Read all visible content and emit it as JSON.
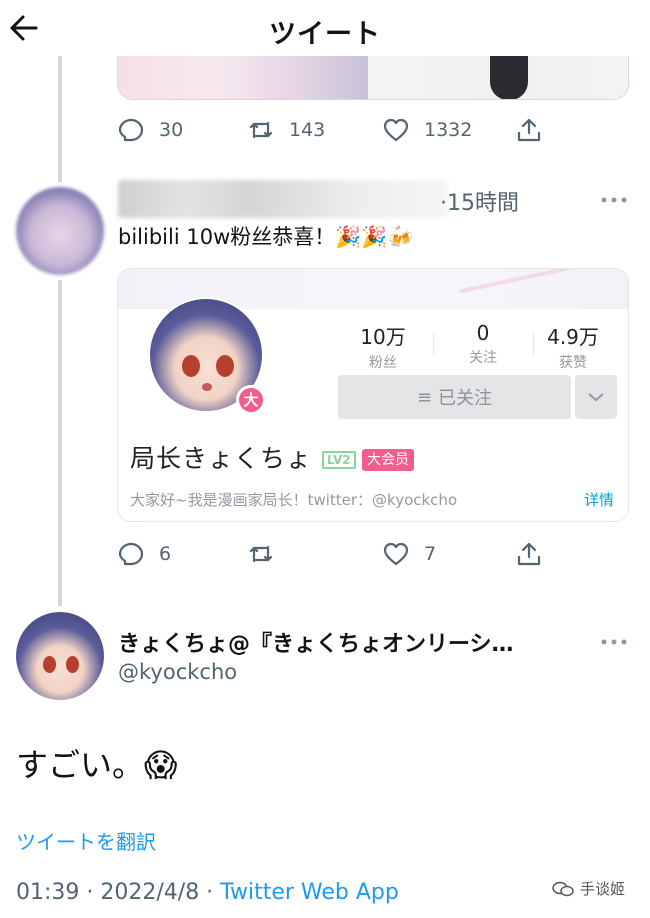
{
  "header": {
    "title": "ツイート"
  },
  "prev_tweet": {
    "reply_count": "30",
    "retweet_count": "143",
    "like_count": "1332"
  },
  "reply_tweet": {
    "time_ago": "·15時間",
    "text": "bilibili 10w粉丝恭喜！🎉🎉🍻",
    "reply_count": "6",
    "retweet_count": "",
    "like_count": "7",
    "card": {
      "avatar_badge": "大",
      "stats": [
        {
          "value": "10万",
          "label": "粉丝"
        },
        {
          "value": "0",
          "label": "关注"
        },
        {
          "value": "4.9万",
          "label": "获赞"
        }
      ],
      "follow_label": "已关注",
      "name": "局长きょくちょ",
      "level": "LV2",
      "vip": "大会员",
      "bio": "大家好~我是漫画家局长！twitter：@kyockcho",
      "detail": "详情"
    }
  },
  "main_tweet": {
    "name": "きょくちょ@『きょくちょオンリーシ…",
    "handle": "@kyockcho",
    "text": "すごい。😱",
    "translate": "ツイートを翻訳",
    "time": "01:39 · 2022/4/8 · ",
    "source": "Twitter Web App"
  },
  "watermark": "手谈姬",
  "colors": {
    "twitter_blue": "#1d9bf0",
    "bilibili_pink": "#f25d8e",
    "bilibili_blue": "#00a1d6",
    "icon_gray": "#536471"
  }
}
